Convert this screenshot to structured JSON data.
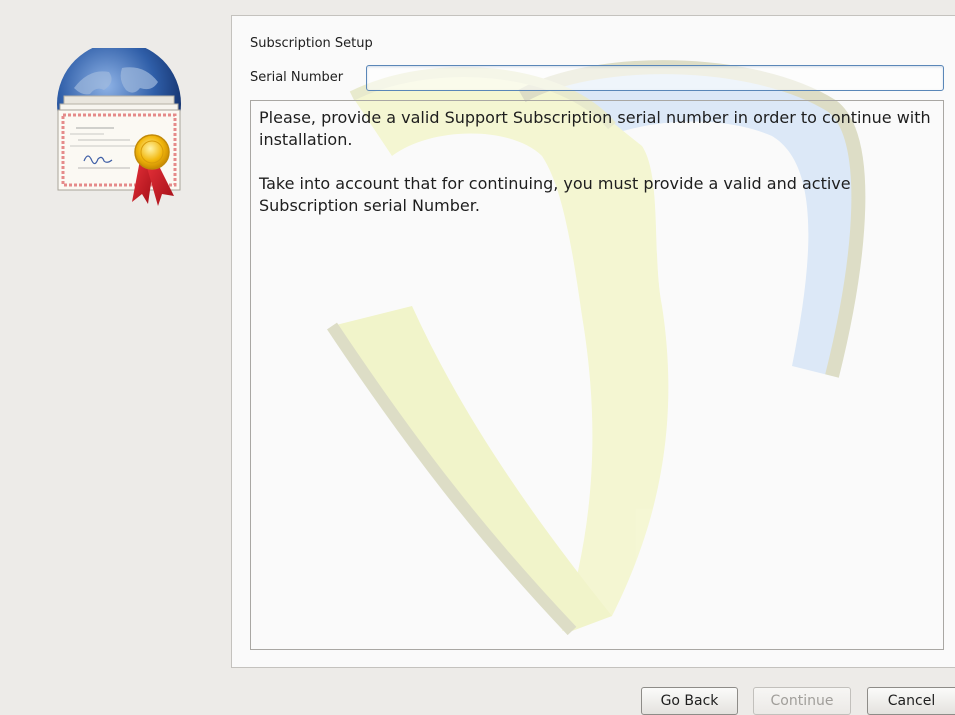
{
  "icons": {
    "certificate": "certificate-icon"
  },
  "setup": {
    "title": "Subscription Setup",
    "serial_label": "Serial Number",
    "serial_value": "",
    "message_line1": "Please, provide a valid Support Subscription serial number in order to continue with installation.",
    "message_line2": "Take into account that for continuing, you must provide a valid and active Subscription serial Number."
  },
  "buttons": {
    "go_back": "Go Back",
    "continue": "Continue",
    "continue_enabled": false,
    "cancel": "Cancel"
  },
  "colors": {
    "window_bg": "#edebe8",
    "input_border": "#5a87b8",
    "watermark_yellow": "#f2f5c8",
    "watermark_blue": "#d7e6f7"
  }
}
